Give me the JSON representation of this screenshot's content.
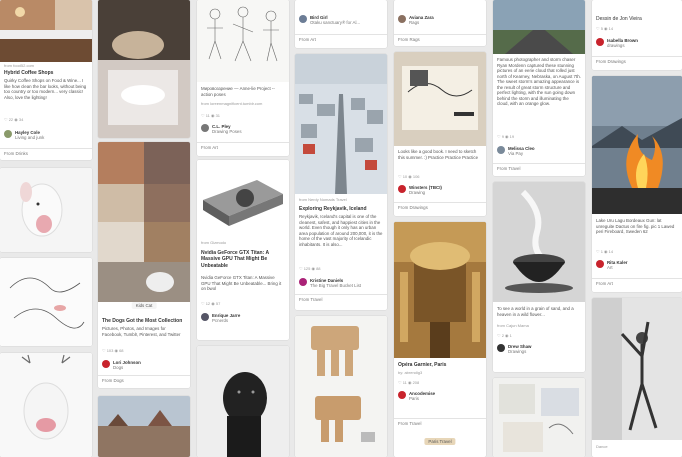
{
  "pins": {
    "coffee": {
      "source": "from food52.com",
      "title": "Hybrid Coffee Shops",
      "desc": "Quirky Coffee Shops on Food & Wine... I like how clean the bar looks, without being too country or too modern... very classic! Also, love the lighting!",
      "stats": "♡ 22  ◉ 34",
      "user": "Hayley Cole",
      "board": "Living and junk",
      "from": "From Drinks"
    },
    "sketch": {
      "title": "Мировоззрение — Anne-lie Project -- action poses",
      "source": "from loreenmagnificent.tumblr.com",
      "stats": "♡ 11  ◉ 31",
      "user": "C.L. Pley",
      "board": "Drawing Poses",
      "from": "From Art"
    },
    "birdgirl": {
      "user": "Bird Girl",
      "board": "Otaku sanctuary® for Al...",
      "from": "From Art"
    },
    "reykjavik": {
      "source": "from Nerdy Nomads Travel",
      "title": "Exploring Reykjavik, Iceland",
      "desc": "Reykjavik, Iceland's capital is one of the cleanest, safest, and happiest cities in the world. Even though it only has an urban area population of around 200,000, it is the home of the vast majority of Icelandic inhabitants. It is also...",
      "stats": "♡ 125  ◉ 88",
      "user": "Kristine Daniels",
      "board": "The Big Travel Bucket List",
      "from": "From Travel"
    },
    "gpu": {
      "source": "from Gizmodo",
      "title": "Nvidia GeForce GTX Titan: A Massive GPU That Might Be Unbeatable",
      "desc": "Nvidia GeForce GTX Titan: A Massive GPU That Might Be Unbeatable... Bring it on bwol",
      "stats": "♡ 12  ◉ 57",
      "user": "Enrique Jarre",
      "board": "Pcnerds"
    },
    "aviana": {
      "user": "Aviana Zara",
      "board": "Rags",
      "from": "From Rags"
    },
    "notebook": {
      "desc": "Looks like a good book. I need to sketch this summer. :) Practice Practice Practice",
      "stats": "♡ 10  ◉ 106",
      "user": "Winsters (TBCI)",
      "board": "Drawing",
      "from": "From Drawings"
    },
    "opera": {
      "title": "Opéra Garnier, Paris",
      "source": "by: abrendig3",
      "stats": "♡ 11  ◉ 208",
      "user": "Ancodemise",
      "board": "Paris",
      "from": "From Travel",
      "badge": "Paris Travel"
    },
    "road": {
      "desc": "Famous photographer and storm chaser Ryan Mordenn captured these stunning pictures of an eerie cloud that rolled just north of Kearney, Nebraska, on August 7th. The sweet storm's amazing appearance is the result of great storm structure and perfect lighting, with the sun going down behind the storm and illuminating the cloud, with an orange glow.",
      "stats": "♡ 9  ◉ 19",
      "user": "Melissa Cleo",
      "board": "Via Pay",
      "from": "From Travel"
    },
    "teacup": {
      "desc": "To see a world in a grain of sand, and a heaven in a wild flower...",
      "source": "from Cajun Mama",
      "stats": "♡ 2  ◉ 1",
      "user": "Drew Shaw",
      "board": "Drawings"
    },
    "dessin": {
      "title": "Dessin de Jon Vieira",
      "stats": "♡ 5  ◉ 14",
      "user": "Isabella Brown",
      "board": "drawings",
      "from": "From Drawings"
    },
    "fire": {
      "desc": "Lake Uru Lagu Bordeaux Gun: lat unreguite Dactus on fire fig. pic 1 Lawed peri Fireboard, Sweden 62",
      "stats": "♡ 1  ◉ 14",
      "user": "Rita Kaler",
      "board": "Art",
      "from": "From Art"
    },
    "dance": {
      "title": "Dance"
    },
    "dog": {
      "title": "The Dogs Got the Most Collection",
      "desc": "Pictures, Photos, and Images for Facebook, Tumblr, Pinterest, and Twitter",
      "stats": "♡ 103  ◉ 68",
      "user": "Lori Johnson",
      "board": "Dogs",
      "from": "From Dogs",
      "badge": "Kids Cat"
    }
  },
  "colors": {
    "pinterest_red": "#c8232c",
    "background": "#e9e9e9"
  }
}
